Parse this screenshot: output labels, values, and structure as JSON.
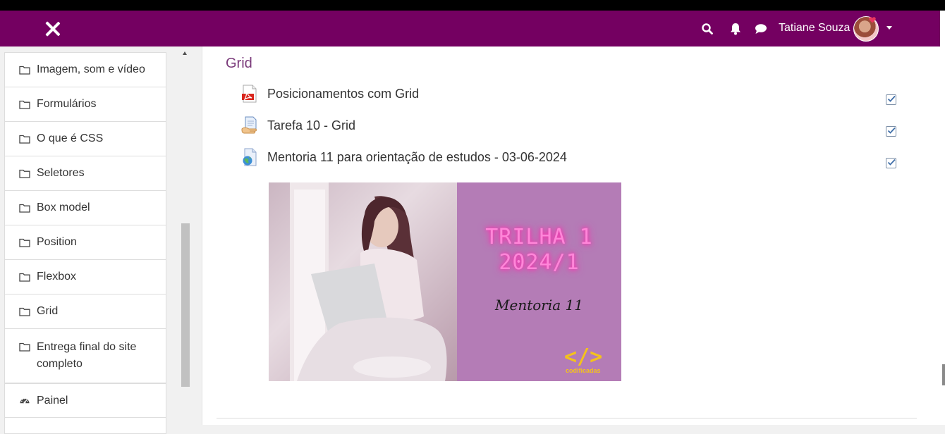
{
  "navbar": {
    "user_name": "Tatiane Souza",
    "brand_color": "#740061"
  },
  "sidebar": {
    "items": [
      {
        "label": "Imagem, som e vídeo"
      },
      {
        "label": "Formulários"
      },
      {
        "label": "O que é CSS"
      },
      {
        "label": "Seletores"
      },
      {
        "label": "Box model"
      },
      {
        "label": "Position"
      },
      {
        "label": "Flexbox"
      },
      {
        "label": "Grid"
      },
      {
        "label": "Entrega final do site completo"
      }
    ],
    "painel_label": "Painel"
  },
  "section": {
    "title": "Grid",
    "activities": [
      {
        "label": "Posicionamentos com Grid",
        "icon": "pdf-icon",
        "completed": true
      },
      {
        "label": "Tarefa 10 - Grid",
        "icon": "assignment-icon",
        "completed": true
      },
      {
        "label": "Mentoria 11 para orientação de estudos - 03-06-2024",
        "icon": "url-icon",
        "completed": true
      }
    ]
  },
  "banner": {
    "line1": "TRILHA 1",
    "line2": "2024/1",
    "subtitle": "Mentoria 11",
    "logo_symbol": "</>",
    "logo_text": "codificadas"
  }
}
